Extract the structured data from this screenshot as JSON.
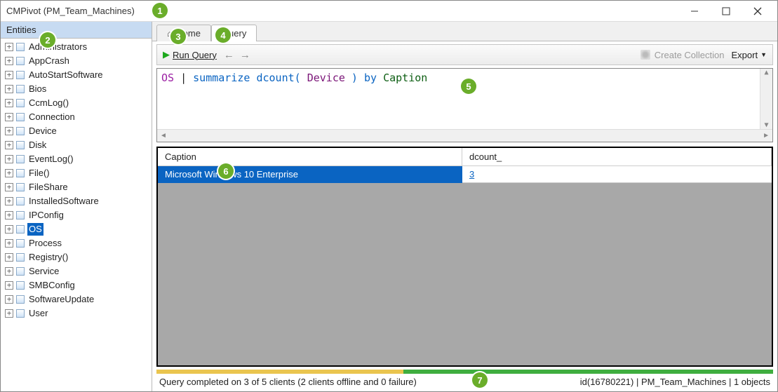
{
  "window": {
    "title": "CMPivot (PM_Team_Machines)"
  },
  "sidebar": {
    "header": "Entities",
    "items": [
      {
        "label": "Administrators",
        "selected": false
      },
      {
        "label": "AppCrash",
        "selected": false
      },
      {
        "label": "AutoStartSoftware",
        "selected": false
      },
      {
        "label": "Bios",
        "selected": false
      },
      {
        "label": "CcmLog()",
        "selected": false
      },
      {
        "label": "Connection",
        "selected": false
      },
      {
        "label": "Device",
        "selected": false
      },
      {
        "label": "Disk",
        "selected": false
      },
      {
        "label": "EventLog()",
        "selected": false
      },
      {
        "label": "File()",
        "selected": false
      },
      {
        "label": "FileShare",
        "selected": false
      },
      {
        "label": "InstalledSoftware",
        "selected": false
      },
      {
        "label": "IPConfig",
        "selected": false
      },
      {
        "label": "OS",
        "selected": true
      },
      {
        "label": "Process",
        "selected": false
      },
      {
        "label": "Registry()",
        "selected": false
      },
      {
        "label": "Service",
        "selected": false
      },
      {
        "label": "SMBConfig",
        "selected": false
      },
      {
        "label": "SoftwareUpdate",
        "selected": false
      },
      {
        "label": "User",
        "selected": false
      }
    ]
  },
  "tabs": {
    "home_label": "Home",
    "query_label": "Query"
  },
  "toolbar": {
    "run_label": "Run Query",
    "create_collection_label": "Create Collection",
    "export_label": "Export"
  },
  "query": {
    "entity": "OS",
    "pipe": " | ",
    "summarize": "summarize",
    "space1": " ",
    "func_open": "dcount( ",
    "col": "Device",
    "func_close": " )",
    "by": " by ",
    "caption": "Caption"
  },
  "results": {
    "columns": {
      "caption": "Caption",
      "dcount": "dcount_"
    },
    "rows": [
      {
        "caption": "Microsoft Windows 10 Enterprise",
        "dcount": "3"
      }
    ]
  },
  "status": {
    "left": "Query completed on 3 of 5 clients (2 clients offline and 0 failure)",
    "right": "id(16780221)  |  PM_Team_Machines  |  1 objects"
  },
  "callouts": {
    "c1": "1",
    "c2": "2",
    "c3": "3",
    "c4": "4",
    "c5": "5",
    "c6": "6",
    "c7": "7"
  }
}
